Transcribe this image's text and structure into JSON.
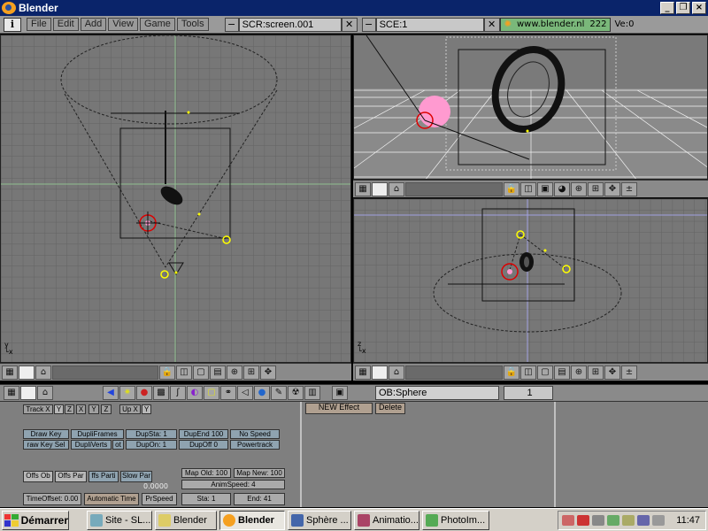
{
  "window": {
    "title": "Blender"
  },
  "header": {
    "info_icon": "i",
    "menus": [
      "File",
      "Edit",
      "Add",
      "View",
      "Game",
      "Tools"
    ],
    "screen_field": "SCR:screen.001",
    "scene_field": "SCE:1",
    "url": "www.blender.nl",
    "version_num": "222",
    "ve_label": "Ve:0"
  },
  "viewports": {
    "top_left_axis": "y",
    "top_left_axis2": "x",
    "bottom_right_axis": "z",
    "bottom_right_axis2": "x"
  },
  "buttons_header": {
    "object_field": "OB:Sphere",
    "frame": "1"
  },
  "buttons": {
    "track_x": "Track X",
    "y": "Y",
    "z": "Z",
    "x": "X",
    "neg_y": "Y",
    "neg_z": "Z",
    "up_x": "Up X",
    "up_y": "Y",
    "new_effect": "NEW Effect",
    "delete": "Delete",
    "draw_key": "Draw Key",
    "dupli_frames": "DupliFrames",
    "dup_sta": "DupSta: 1",
    "dup_end": "DupEnd 100",
    "no_speed": "No Speed",
    "draw_key_sel": "raw Key Sel",
    "dupli_verts": "DupliVerts",
    "rot": "ot",
    "dup_on": "DupOn: 1",
    "dup_off": "DupOff 0",
    "powertrack": "Powertrack",
    "offs_ob": "Offs Ob",
    "offs_par": "Offs Par",
    "offs_parti": "ffs Parti",
    "slow_par": "Slow Par",
    "map_old": "Map Old: 100",
    "map_new": "Map New: 100",
    "anim_speed": "AnimSpeed: 4",
    "zero_value": "0.0000",
    "time_offset": "TimeOffset: 0.00",
    "automatic_time": "Automatic Time",
    "pr_speed": "PrSpeed",
    "sta": "Sta: 1",
    "end": "End: 41"
  },
  "taskbar": {
    "start": "Démarrer",
    "tasks": [
      "Site - SL...",
      "Blender",
      "Blender",
      "Sphère ...",
      "Animatio...",
      "PhotoIm..."
    ],
    "clock": "11:47"
  },
  "colors": {
    "grid_bg": "#777777",
    "selection_red": "#d00000",
    "pink": "#ff9ad0"
  }
}
